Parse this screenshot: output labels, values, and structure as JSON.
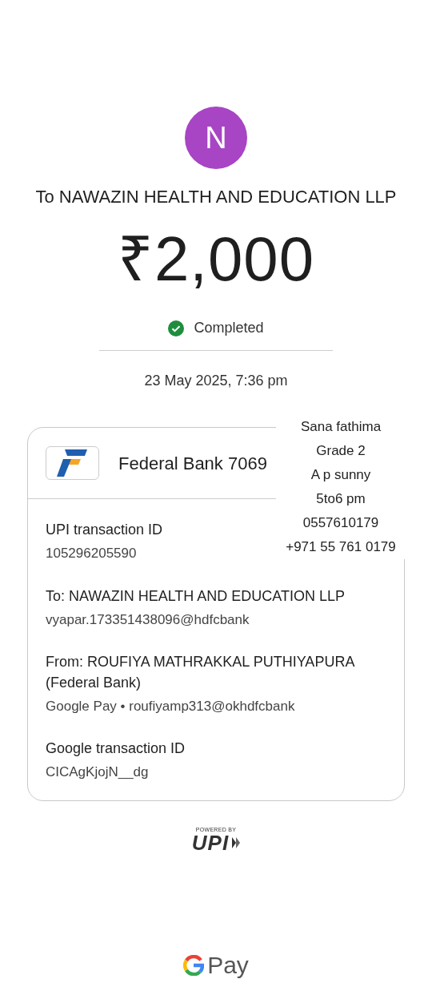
{
  "avatar": {
    "initial": "N"
  },
  "payee_line": "To NAWAZIN HEALTH AND EDUCATION LLP",
  "amount": {
    "currency": "₹",
    "value": "2,000"
  },
  "status": {
    "label": "Completed",
    "completed": true
  },
  "datetime": "23 May 2025, 7:36 pm",
  "account": {
    "name": "Federal Bank 7069"
  },
  "details": [
    {
      "label": "UPI transaction ID",
      "value": "105296205590"
    },
    {
      "label": "To: NAWAZIN HEALTH AND EDUCATION LLP",
      "value": "vyapar.173351438096@hdfcbank"
    },
    {
      "label": "From: ROUFIYA MATHRAKKAL PUTHIYAPURA (Federal Bank)",
      "value": "Google Pay • roufiyamp313@okhdfcbank"
    },
    {
      "label": "Google transaction ID",
      "value": "CICAgKjojN__dg"
    }
  ],
  "note": [
    "Sana fathima",
    "Grade 2",
    "A p sunny",
    "5to6 pm",
    "0557610179",
    "+971 55 761 0179"
  ],
  "upi_badge": {
    "caption": "POWERED BY",
    "mark": "UPI"
  },
  "footer": {
    "brand": "Pay"
  }
}
